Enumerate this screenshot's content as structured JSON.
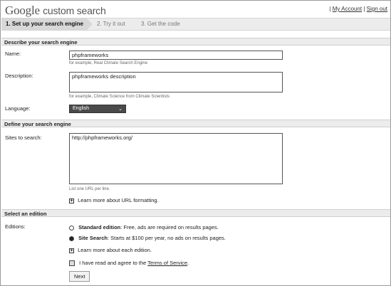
{
  "header": {
    "logo_google": "Google",
    "logo_product": "custom search",
    "links": {
      "sep1": "|",
      "my_account": "My Account",
      "sep2": "|",
      "sign_out": "Sign out"
    }
  },
  "steps": [
    {
      "label": "1. Set up your search engine"
    },
    {
      "label": "2. Try it out"
    },
    {
      "label": "3. Get the code"
    }
  ],
  "describe": {
    "header": "Describe your search engine",
    "name_label": "Name:",
    "name_value": "phpframeworks",
    "name_hint": "for example, Real Climate Search Engine",
    "desc_label": "Description:",
    "desc_value": "phpframeworks description",
    "desc_hint": "for example, Climate Science from Climate Scientists",
    "lang_label": "Language:",
    "lang_value": "English"
  },
  "define": {
    "header": "Define your search engine",
    "sites_label": "Sites to search:",
    "sites_value": "http://phpframeworks.org/",
    "sites_hint": "List one URL per line.",
    "learn_more": "Learn more about URL formatting."
  },
  "edition": {
    "header": "Select an edition",
    "editions_label": "Editions:",
    "standard_title": "Standard edition",
    "standard_desc": ": Free, ads are required on results pages.",
    "site_title": "Site Search",
    "site_desc": ": Starts at $100 per year, no ads on results pages.",
    "learn_more": "Learn more about each edition.",
    "agree_prefix": "I have read and agree to the ",
    "agree_link": "Terms of Service",
    "agree_suffix": ".",
    "next_label": "Next"
  },
  "icons": {
    "plus": "+",
    "chevron": "⌄"
  }
}
